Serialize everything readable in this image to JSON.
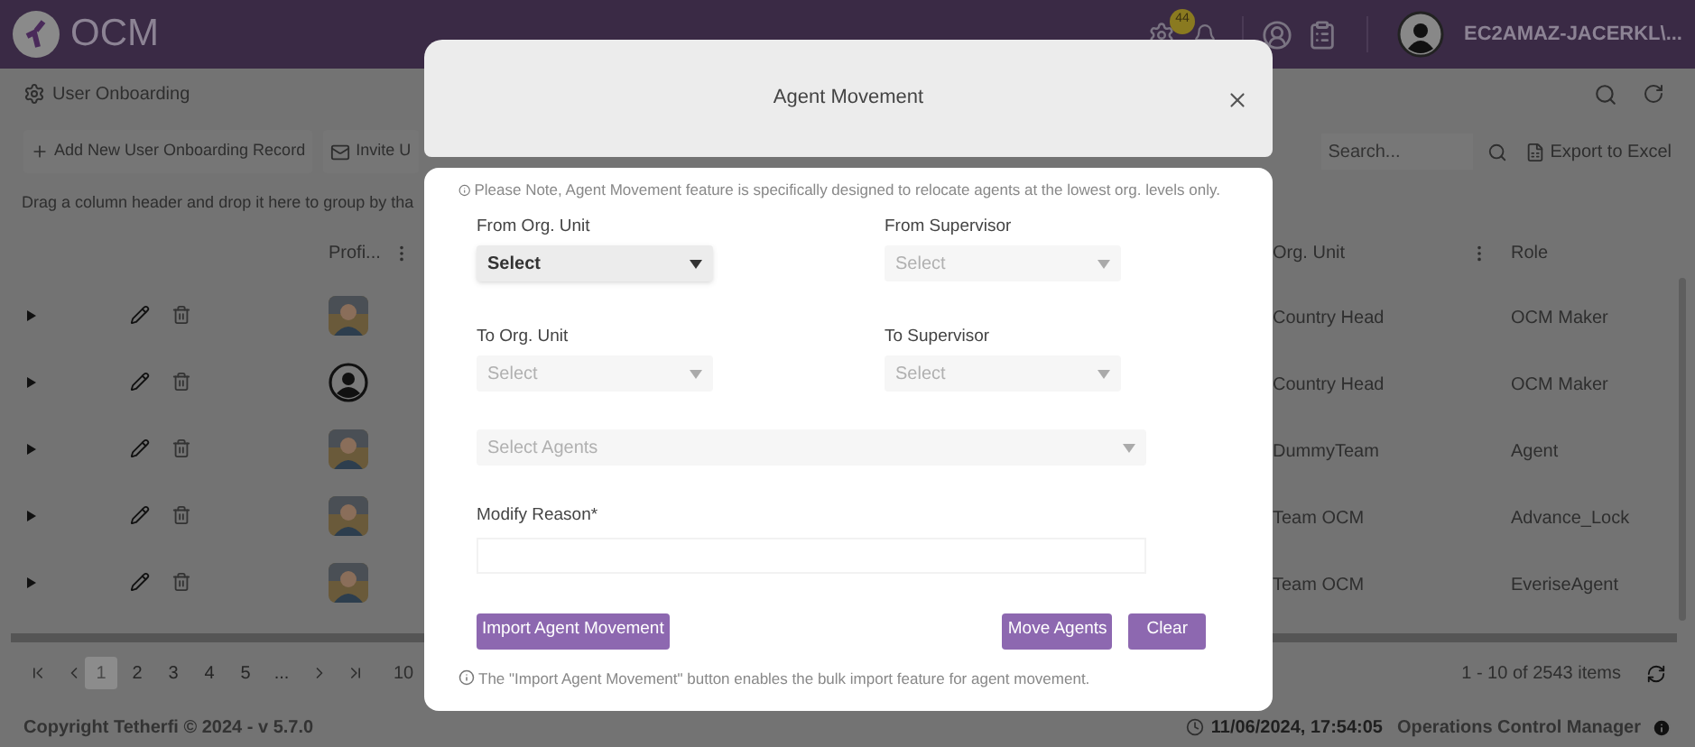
{
  "header": {
    "app_name": "OCM",
    "notification_badge": "44",
    "user_name": "EC2AMAZ-JACERKL\\..."
  },
  "page": {
    "title": "User Onboarding",
    "toolbar": [
      {
        "label": "Add New User Onboarding Record",
        "kind": "add"
      },
      {
        "label": "Invite U",
        "kind": "invite"
      }
    ],
    "search": {
      "placeholder": "Search..."
    },
    "export_label": "Export to Excel",
    "group_panel": "Drag a column header and drop it here to group by tha"
  },
  "table": {
    "columns": [
      {
        "label": "Profi...",
        "menu": true
      },
      {
        "label": "Org. Unit",
        "menu": true
      },
      {
        "label": "Role"
      }
    ],
    "rows": [
      {
        "org_unit": "Country Head",
        "role": "OCM Maker"
      },
      {
        "kind": "icon",
        "org_unit": "Country Head",
        "role": "OCM Maker"
      },
      {
        "org_unit": "DummyTeam",
        "role": "Agent"
      },
      {
        "org_unit": "Team OCM",
        "role": "Advance_Lock"
      },
      {
        "org_unit": "Team OCM",
        "role": "EveriseAgent"
      }
    ]
  },
  "pager": {
    "pages": [
      {
        "label": "1",
        "selected": true
      },
      {
        "label": "2",
        "selected": false
      },
      {
        "label": "3",
        "selected": false
      },
      {
        "label": "4",
        "selected": false
      },
      {
        "label": "5",
        "selected": false
      },
      {
        "label": "...",
        "selected": false
      }
    ],
    "page_size": "10",
    "summary": "1 - 10 of 2543 items"
  },
  "footer": {
    "copyright": "Copyright Tetherfi © 2024 - v 5.7.0",
    "timestamp": "11/06/2024, 17:54:05",
    "app": "Operations Control Manager"
  },
  "dialog": {
    "title": "Agent Movement",
    "note": "Please Note, Agent Movement feature is specifically designed to relocate agents at the lowest org. levels only.",
    "fields": [
      {
        "label": "From Org. Unit",
        "placeholder": "Select",
        "disabled": false
      },
      {
        "label": "From Supervisor",
        "placeholder": "Select",
        "disabled": true
      },
      {
        "label": "To Org. Unit",
        "placeholder": "Select",
        "disabled": true
      },
      {
        "label": "To Supervisor",
        "placeholder": "Select",
        "disabled": true
      }
    ],
    "agents": {
      "placeholder": "Select Agents",
      "disabled": true
    },
    "reason_label": "Modify Reason*",
    "buttons": [
      {
        "label": "Import Agent Movement",
        "kind": "import"
      },
      {
        "label": "Move Agents",
        "kind": "move"
      },
      {
        "label": "Clear",
        "kind": "clear"
      }
    ],
    "footnote": "The \"Import Agent Movement\" button enables the bulk import feature for agent movement."
  }
}
